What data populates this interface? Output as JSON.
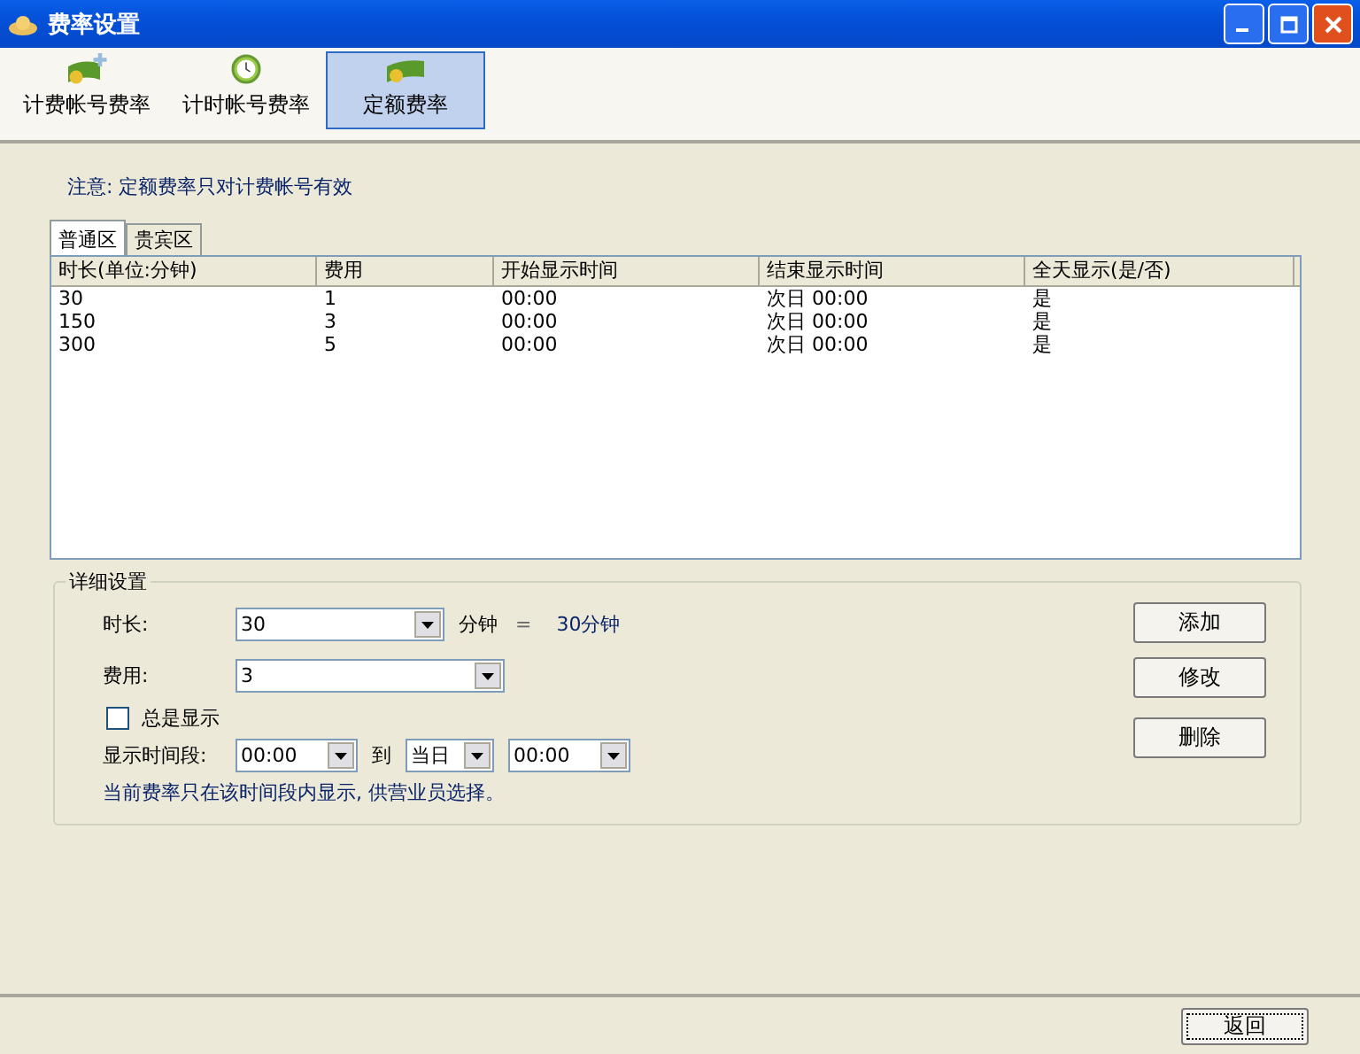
{
  "window": {
    "title": "费率设置"
  },
  "toolbar": [
    {
      "label": "计费帐号费率",
      "selected": false
    },
    {
      "label": "计时帐号费率",
      "selected": false
    },
    {
      "label": "定额费率",
      "selected": true
    }
  ],
  "notice": "注意:  定额费率只对计费帐号有效",
  "tabs": [
    {
      "label": "普通区",
      "selected": true
    },
    {
      "label": "贵宾区",
      "selected": false
    }
  ],
  "table": {
    "columns": [
      "时长(单位:分钟)",
      "费用",
      "开始显示时间",
      "结束显示时间",
      "全天显示(是/否)"
    ],
    "rows": [
      [
        "30",
        "1",
        "00:00",
        "次日 00:00",
        "是"
      ],
      [
        "150",
        "3",
        "00:00",
        "次日 00:00",
        "是"
      ],
      [
        "300",
        "5",
        "00:00",
        "次日 00:00",
        "是"
      ]
    ]
  },
  "details": {
    "title": "详细设置",
    "duration_label": "时长:",
    "duration_value": "30",
    "duration_unit": "分钟",
    "equals": "=",
    "duration_result": "30分钟",
    "fee_label": "费用:",
    "fee_value": "3",
    "always_show": {
      "label": "总是显示",
      "checked": false
    },
    "period_label": "显示时间段:",
    "period_start": "00:00",
    "to": "到",
    "period_day": "当日",
    "period_end": "00:00",
    "hint": "当前费率只在该时间段内显示, 供营业员选择。"
  },
  "buttons": [
    "添加",
    "修改",
    "删除"
  ],
  "back_button": "返回"
}
